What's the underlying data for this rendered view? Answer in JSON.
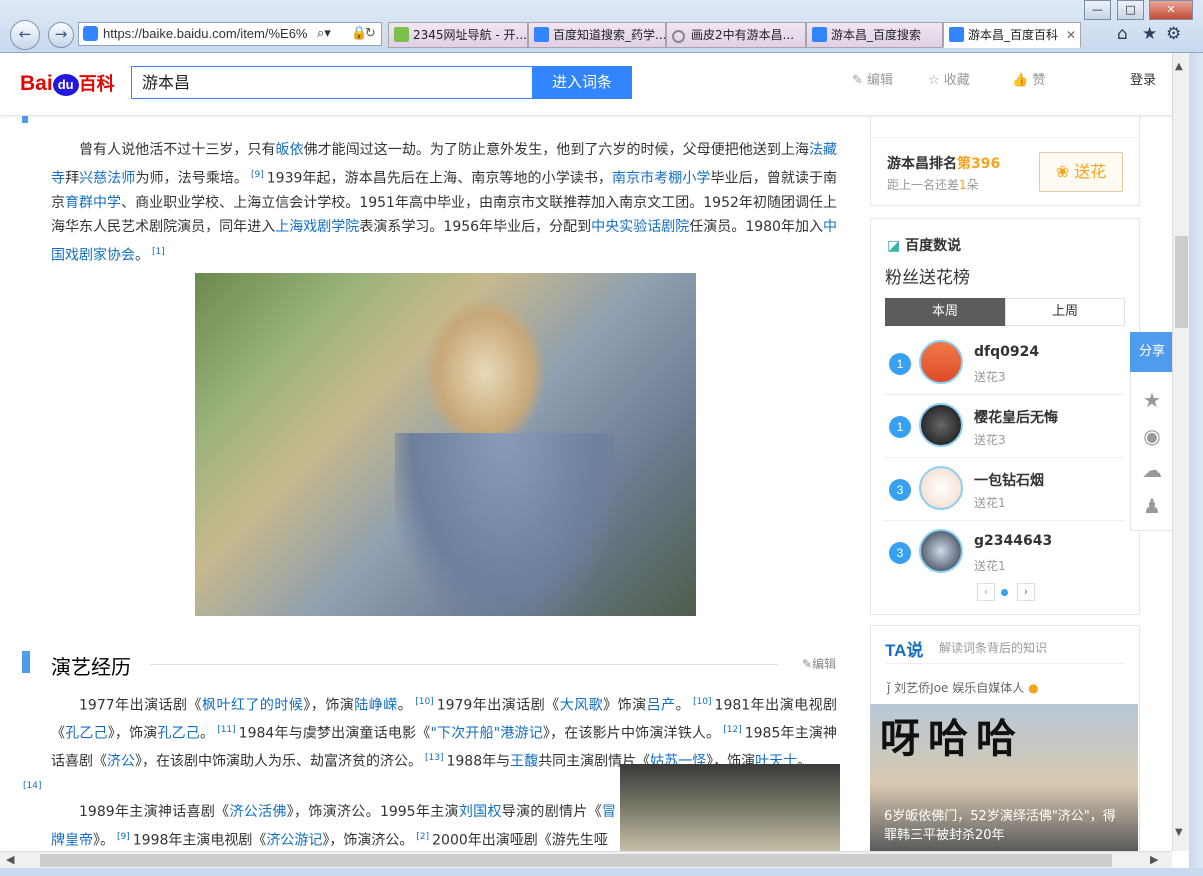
{
  "browser": {
    "url": "https://baike.baidu.com/item/%E6%",
    "tabs": [
      {
        "label": "2345网址导航 - 开...",
        "active": false
      },
      {
        "label": "百度知道搜索_药学...",
        "active": false
      },
      {
        "label": "画皮2中有游本昌...",
        "active": false
      },
      {
        "label": "游本昌_百度搜索",
        "active": false
      },
      {
        "label": "游本昌_百度百科",
        "active": true
      }
    ],
    "winbuttons": [
      "—",
      "□",
      "✕"
    ]
  },
  "header": {
    "logo_bai": "Bai",
    "logo_du": "du",
    "logo_baike": "百科",
    "search_value": "游本昌",
    "enter_label": "进入词条",
    "edit_label": "编辑",
    "fav_label": "收藏",
    "like_label": "赞",
    "login_label": "登录"
  },
  "early": {
    "p1_a": "曾有人说他活不过十三岁，只有",
    "p1_link1": "皈依",
    "p1_b": "佛才能闯过这一劫。为了防止意外发生，他到了六岁的时候，父母便把他送到上海",
    "p1_link2": "法藏寺",
    "p1_c": "拜",
    "p1_link3": "兴慈法师",
    "p1_d": "为师，法号乘培。",
    "p1_ref1": "[9]",
    "p1_e": "1939年起，游本昌先后在上海、南京等地的小学读书，",
    "p1_link4": "南京市考棚小学",
    "p1_f": "毕业后，曾就读于南京",
    "p1_link5": "育群中学",
    "p1_g": "、商业职业学校、上海立信会计学校。1951年高中毕业，由南京市文联推荐加入南京文工团。1952年初随团调任上海华东人民艺术剧院演员，同年进入",
    "p1_link6": "上海戏剧学院",
    "p1_h": "表演系学习。1956年毕业后，分配到",
    "p1_link7": "中央实验话剧院",
    "p1_i": "任演员。1980年加入",
    "p1_link8": "中国戏剧家协会",
    "p1_j": "。",
    "p1_ref2": "[1]"
  },
  "career": {
    "title": "演艺经历",
    "edit_label": "编辑",
    "p2_a": "1977年出演话剧《",
    "p2_l1": "枫叶红了的时候",
    "p2_b": "》，饰演",
    "p2_l2": "陆峥嵘",
    "p2_c": "。",
    "p2_r1": "[10]",
    "p2_d": "1979年出演话剧《",
    "p2_l3": "大风歌",
    "p2_e": "》饰演",
    "p2_l4": "吕产",
    "p2_f": "。",
    "p2_r2": "[10]",
    "p2_g": "1981年出演电视剧《",
    "p2_l5": "孔乙己",
    "p2_h": "》，饰演",
    "p2_l6": "孔乙己",
    "p2_i": "。",
    "p2_r3": "[11]",
    "p2_j": "1984年与虞梦出演童话电影《",
    "p2_l7": "\"下次开船\"港游记",
    "p2_k": "》，在该影片中饰演洋铁人。",
    "p2_r4": "[12]",
    "p2_m": "1985年主演神话喜剧《",
    "p2_l8": "济公",
    "p2_n": "》，在该剧中饰演助人为乐、劫富济贫的济公。",
    "p2_r5": "[13]",
    "p2_o": "1988年与",
    "p2_l9": "王馥",
    "p2_p": "共同主演剧情片《",
    "p2_l10": "姑苏一怪",
    "p2_q": "》，饰演",
    "p2_l11": "叶天士",
    "p2_s": "。",
    "p2_r6": "[14]",
    "p3_a": "1989年主演神话喜剧《",
    "p3_l1": "济公活佛",
    "p3_b": "》，饰演济公。1995年主演",
    "p3_l2": "刘国权",
    "p3_c": "导演的剧情片《",
    "p3_l3": "冒牌皇帝",
    "p3_d": "》。",
    "p3_r1": "[9]",
    "p3_e": "1998年主演电视剧《",
    "p3_l4": "济公游记",
    "p3_f": "》，饰演济公。",
    "p3_r2": "[2]",
    "p3_g": "2000年出演哑剧《游先生哑"
  },
  "sidebar": {
    "rank_label": "游本昌排名",
    "rank_value": "第396",
    "gap_prefix": "距上一名还差",
    "gap_value": "1",
    "gap_suffix": "朵",
    "send_flower": "送花",
    "datasay": "百度数说",
    "fans_title": "粉丝送花榜",
    "tab_this_week": "本周",
    "tab_last_week": "上周",
    "fans": [
      {
        "rank": "1",
        "name": "dfq0924",
        "flowers": "送花3"
      },
      {
        "rank": "1",
        "name": "樱花皇后无悔",
        "flowers": "送花3"
      },
      {
        "rank": "3",
        "name": "一包钻石烟",
        "flowers": "送花1"
      },
      {
        "rank": "3",
        "name": "g2344643",
        "flowers": "送花1"
      }
    ],
    "ta_logo": "TA说",
    "ta_sub": "解读词条背后的知识",
    "author": "刘艺侨Joe",
    "author_tag": "娱乐自媒体人",
    "video_title_text": "呀哈哈",
    "video_caption": "6岁皈依佛门，52岁演绎活佛\"济公\"，得罪韩三平被封杀20年"
  },
  "share": {
    "label": "分享"
  }
}
